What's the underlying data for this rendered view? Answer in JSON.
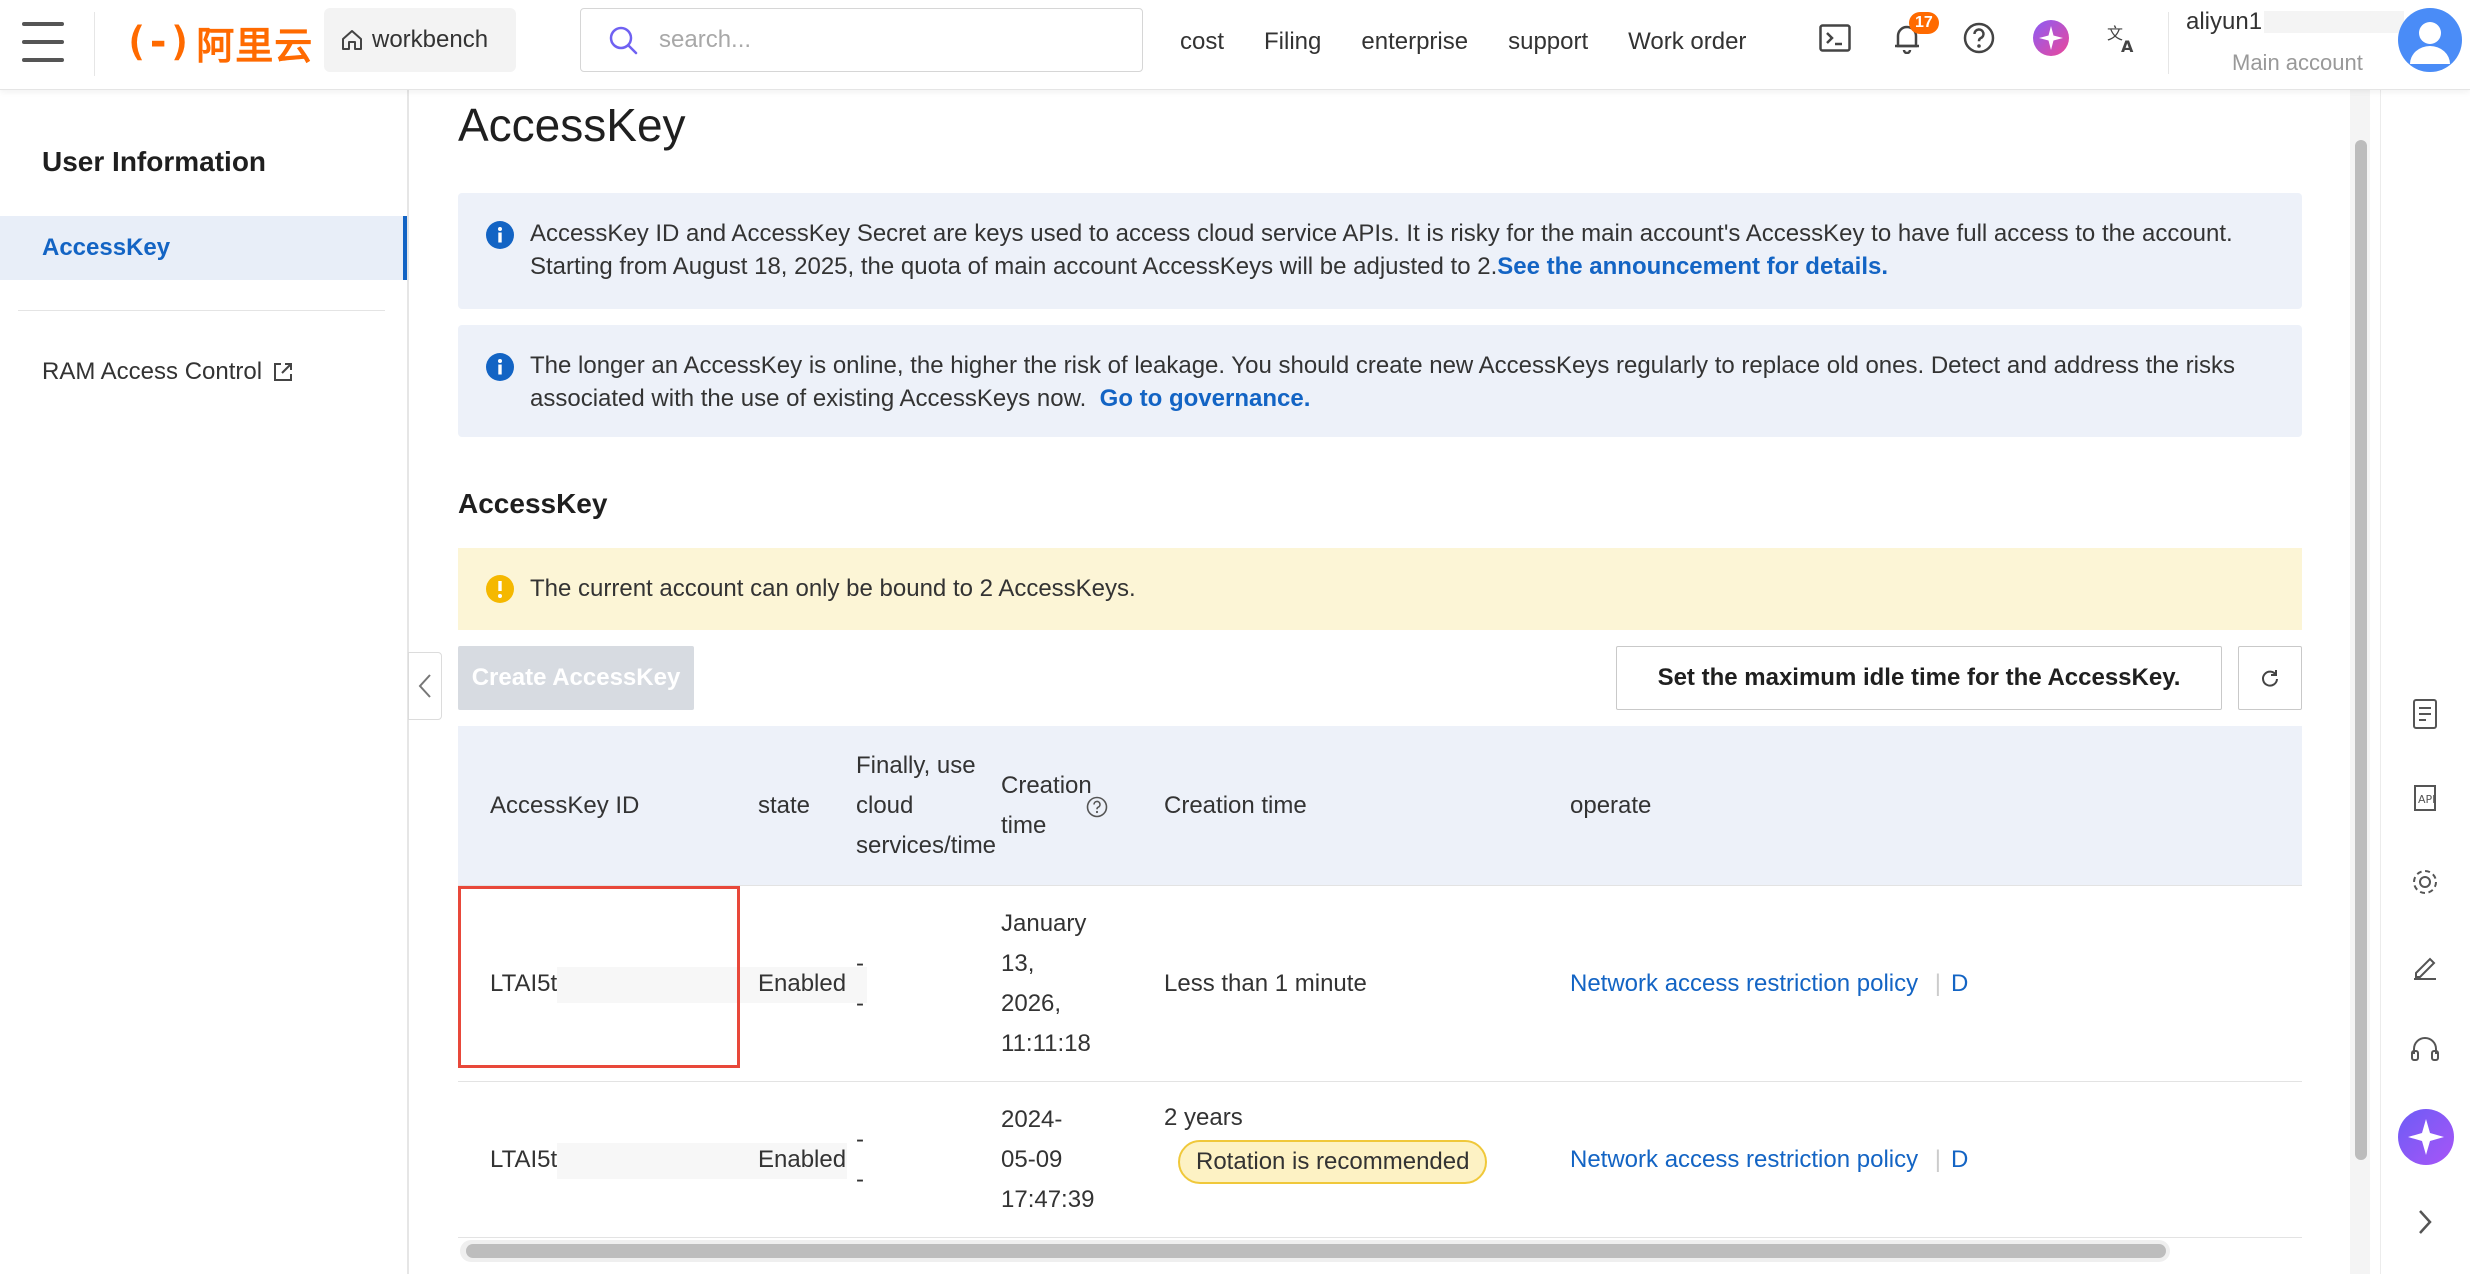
{
  "topbar": {
    "logo_mark": "(-)",
    "logo_text": "阿里云",
    "workbench_label": "workbench",
    "search_placeholder": "search...",
    "nav": [
      "cost",
      "Filing",
      "enterprise",
      "support",
      "Work order"
    ],
    "notification_count": "17",
    "account_name": "aliyun1",
    "account_role": "Main account"
  },
  "sidebar": {
    "title": "User Information",
    "active_item": "AccessKey",
    "ram_item": "RAM Access Control"
  },
  "main": {
    "page_title": "AccessKey",
    "notice1_text": "AccessKey ID and AccessKey Secret are keys used to access cloud service APIs. It is risky for the main account's AccessKey to have full access to the account. Starting from August 18, 2025, the quota of main account AccessKeys will be adjusted to 2.",
    "notice1_link": "See the announcement for details.",
    "notice2_text": "The longer an AccessKey is online, the higher the risk of leakage. You should create new AccessKeys regularly to replace old ones. Detect and address the risks associated with the use of existing AccessKeys now.",
    "notice2_link": "Go to governance.",
    "section_title": "AccessKey",
    "warning_text": "The current account can only be bound to 2 AccessKeys.",
    "create_button": "Create AccessKey",
    "idle_button": "Set the maximum idle time for the AccessKey."
  },
  "table": {
    "headers": {
      "id": "AccessKey ID",
      "state": "state",
      "last_use": [
        "Finally, use",
        "cloud",
        "services/time"
      ],
      "creation_time": [
        "Creation",
        "time"
      ],
      "creation_age": "Creation time",
      "operate": "operate"
    },
    "rows": [
      {
        "id_prefix": "LTAI5t",
        "state": "Enabled",
        "last_use": [
          "-",
          "-"
        ],
        "created": [
          "January",
          "13,",
          "2026,",
          "11:11:18"
        ],
        "age": "Less than 1 minute",
        "badge": "",
        "op_link": "Network access restriction policy",
        "op_more": "D"
      },
      {
        "id_prefix": "LTAI5t",
        "state": "Enabled",
        "last_use": [
          "-",
          "-"
        ],
        "created": [
          "2024-",
          "05-09",
          "17:47:39"
        ],
        "age": "2 years",
        "badge": "Rotation is recommended",
        "op_link": "Network access restriction policy",
        "op_more": "D"
      }
    ]
  },
  "colors": {
    "brand": "#ff6a00",
    "link": "#1364c4",
    "highlight_border": "#e8483a",
    "notice_bg": "#edf1f9",
    "warning_bg": "#fcf5d6"
  }
}
